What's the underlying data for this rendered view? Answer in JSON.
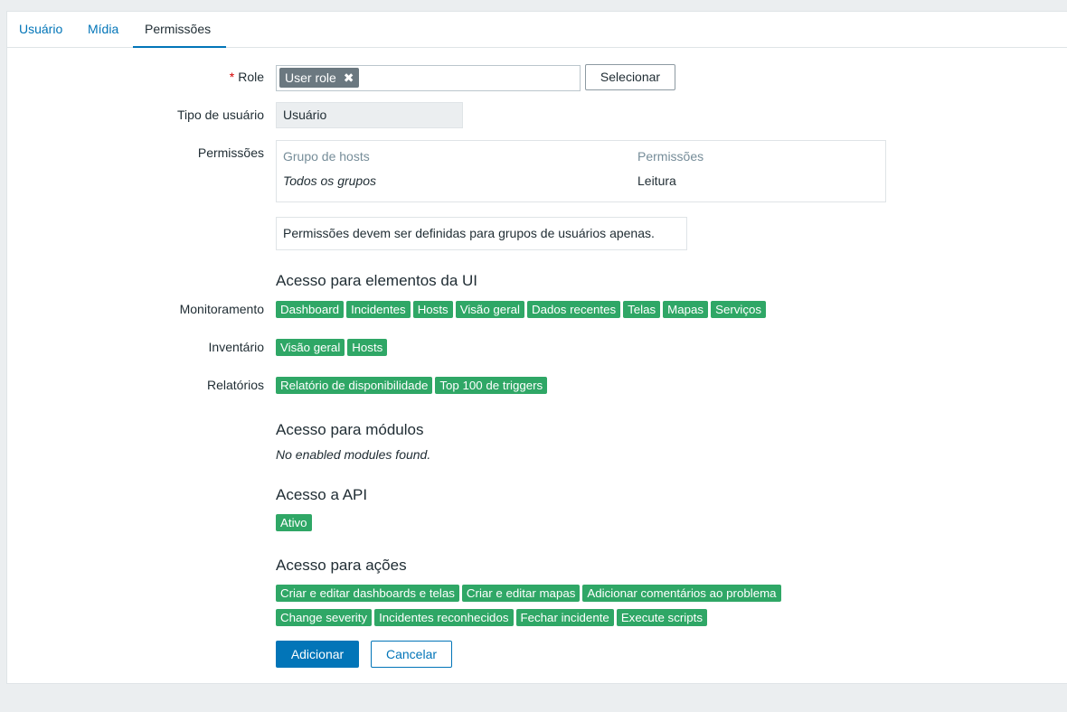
{
  "tabs": [
    {
      "label": "Usuário"
    },
    {
      "label": "Mídia"
    },
    {
      "label": "Permissões"
    }
  ],
  "form": {
    "role_label": "Role",
    "role_required_marker": "*",
    "role_chip": "User role",
    "role_chip_remove": "✖",
    "select_button": "Selecionar",
    "user_type_label": "Tipo de usuário",
    "user_type_value": "Usuário",
    "permissions_label": "Permissões",
    "permissions_table": {
      "col_host_group": "Grupo de hosts",
      "col_permissions": "Permissões",
      "row_host_group": "Todos os grupos",
      "row_permission": "Leitura"
    },
    "permissions_info": "Permissões devem ser definidas para grupos de usuários apenas."
  },
  "ui_access": {
    "title": "Acesso para elementos da UI",
    "monitoring_label": "Monitoramento",
    "monitoring": [
      "Dashboard",
      "Incidentes",
      "Hosts",
      "Visão geral",
      "Dados recentes",
      "Telas",
      "Mapas",
      "Serviços"
    ],
    "inventory_label": "Inventário",
    "inventory": [
      "Visão geral",
      "Hosts"
    ],
    "reports_label": "Relatórios",
    "reports": [
      "Relatório de disponibilidade",
      "Top 100 de triggers"
    ]
  },
  "modules": {
    "title": "Acesso para módulos",
    "note": "No enabled modules found."
  },
  "api": {
    "title": "Acesso a API",
    "status": "Ativo"
  },
  "actions": {
    "title": "Acesso para ações",
    "row1": [
      "Criar e editar dashboards e telas",
      "Criar e editar mapas",
      "Adicionar comentários ao problema"
    ],
    "row2": [
      "Change severity",
      "Incidentes reconhecidos",
      "Fechar incidente",
      "Execute scripts"
    ]
  },
  "buttons": {
    "add": "Adicionar",
    "cancel": "Cancelar"
  },
  "colors": {
    "accent": "#0275b8",
    "tag_green": "#2fa766",
    "chip_gray": "#6b7880",
    "required": "#d40000"
  }
}
